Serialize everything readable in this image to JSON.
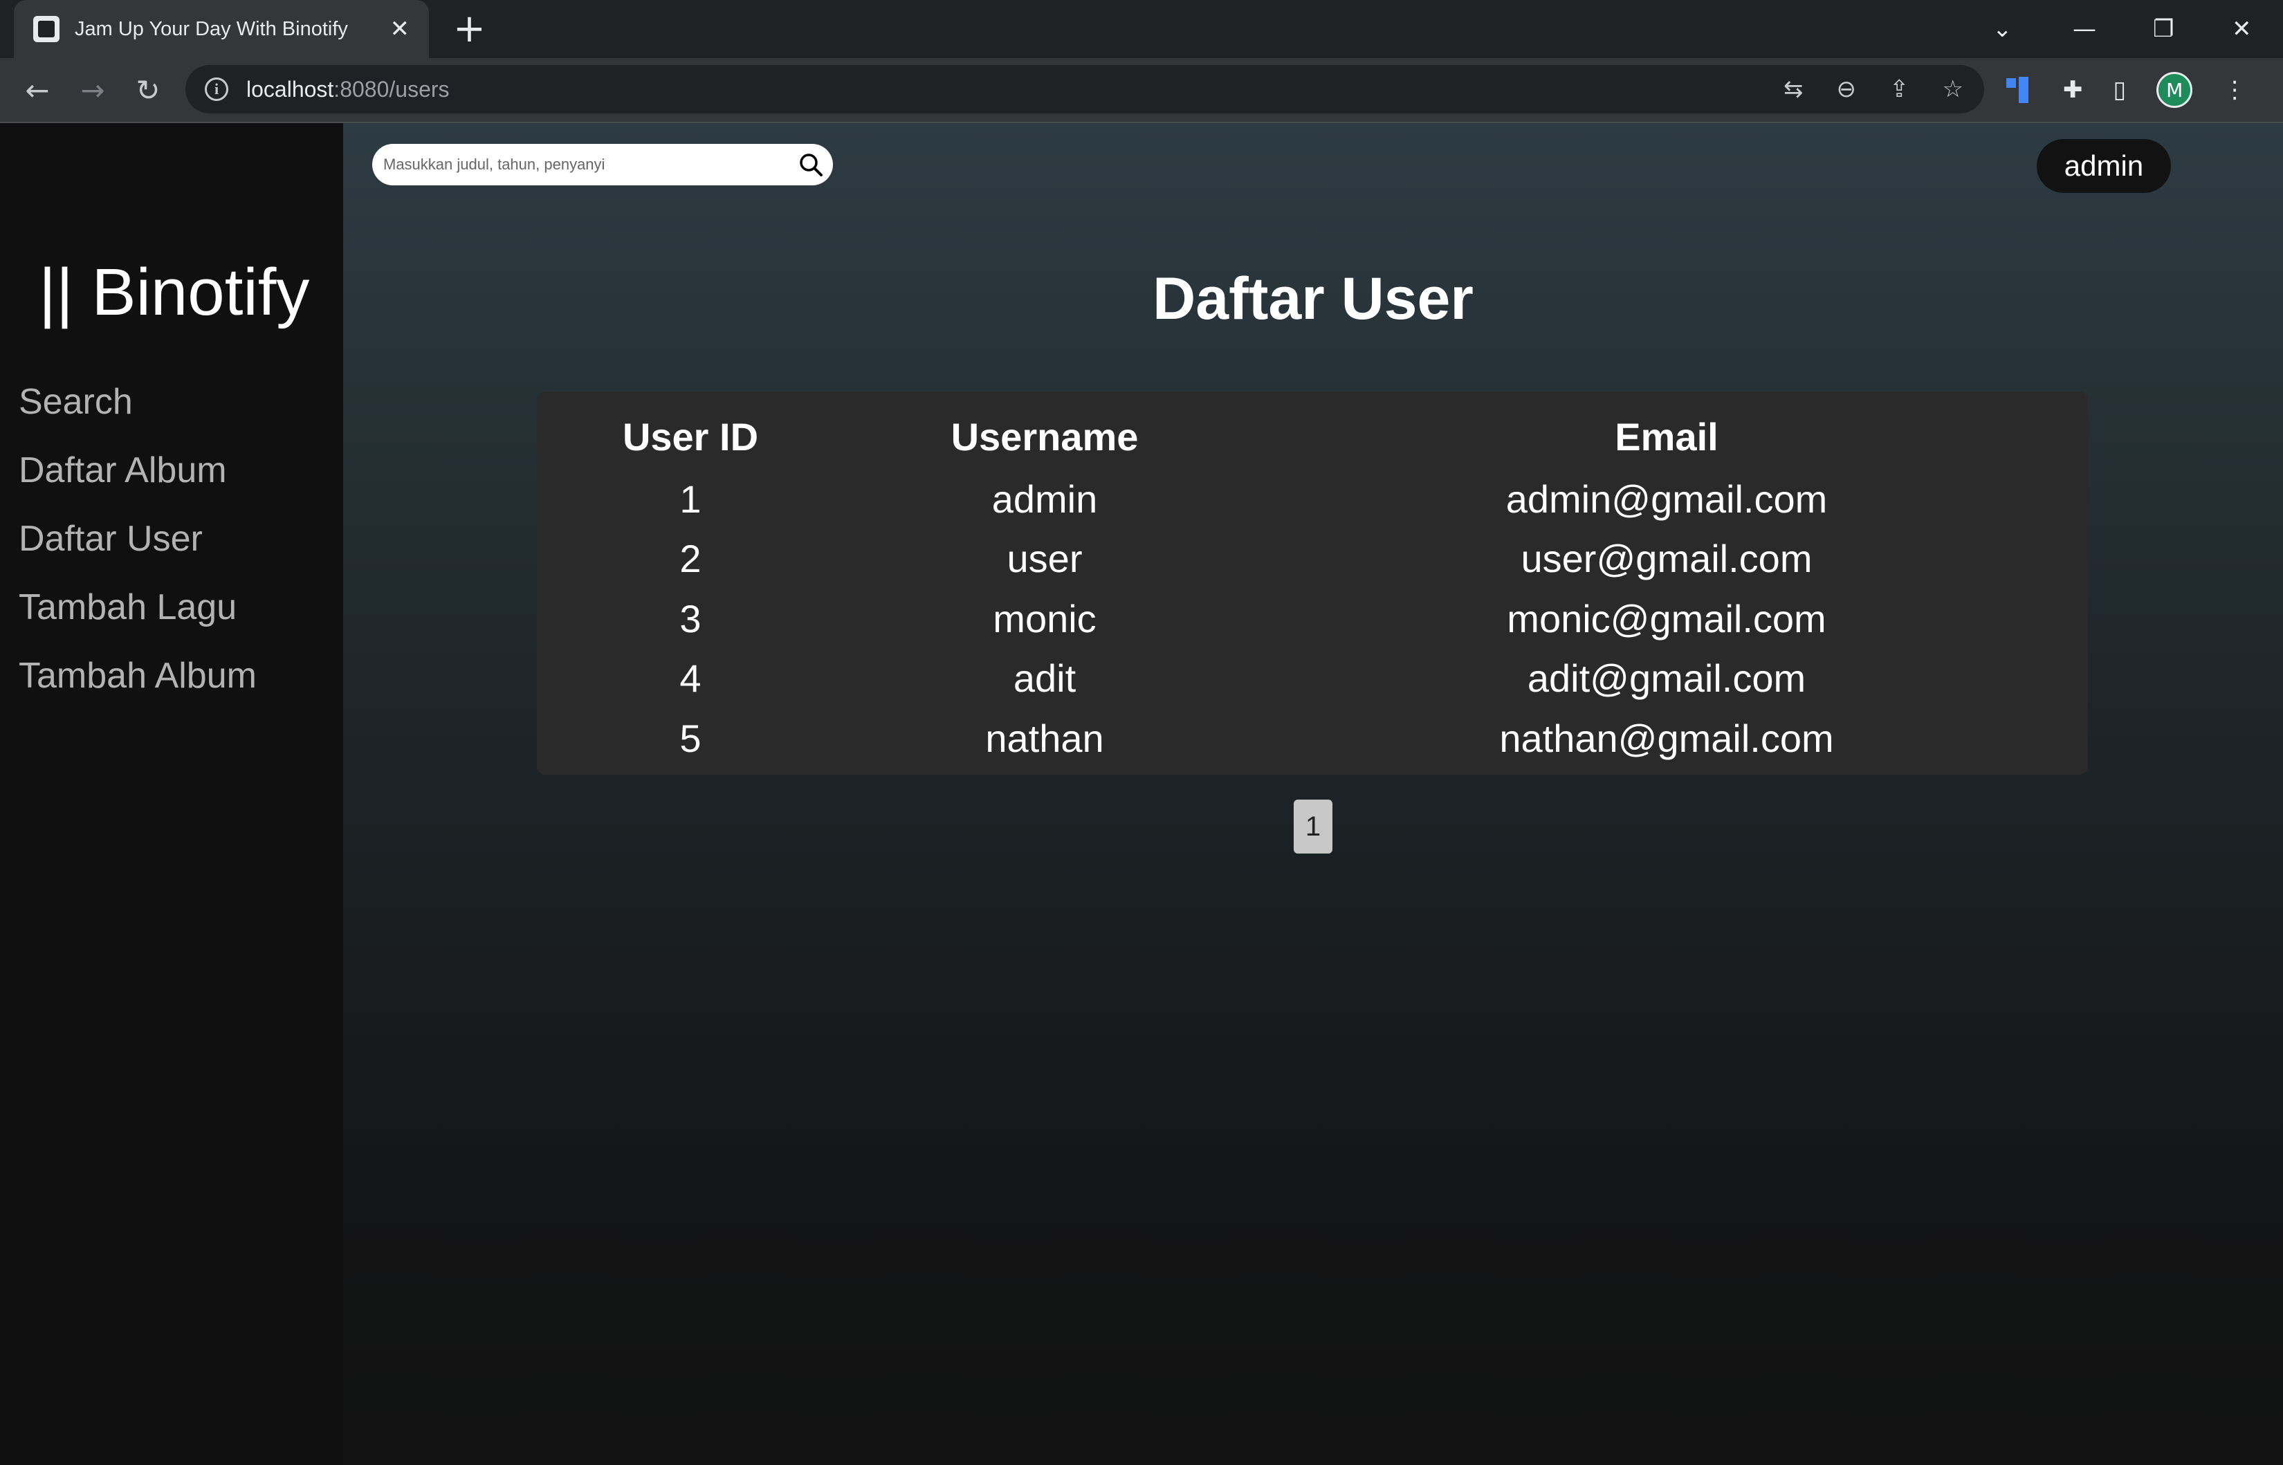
{
  "browser": {
    "tab_title": "Jam Up Your Day With Binotify",
    "url_host": "localhost",
    "url_path": ":8080/users",
    "profile_initial": "M"
  },
  "sidebar": {
    "brand": "|| Binotify",
    "items": [
      {
        "label": "Search"
      },
      {
        "label": "Daftar Album"
      },
      {
        "label": "Daftar User"
      },
      {
        "label": "Tambah Lagu"
      },
      {
        "label": "Tambah Album"
      }
    ]
  },
  "header": {
    "search_placeholder": "Masukkan judul, tahun, penyanyi",
    "username": "admin"
  },
  "main": {
    "title": "Daftar User",
    "table": {
      "columns": [
        "User ID",
        "Username",
        "Email"
      ],
      "rows": [
        [
          "1",
          "admin",
          "admin@gmail.com"
        ],
        [
          "2",
          "user",
          "user@gmail.com"
        ],
        [
          "3",
          "monic",
          "monic@gmail.com"
        ],
        [
          "4",
          "adit",
          "adit@gmail.com"
        ],
        [
          "5",
          "nathan",
          "nathan@gmail.com"
        ]
      ]
    },
    "pagination": {
      "current_page": "1"
    }
  }
}
